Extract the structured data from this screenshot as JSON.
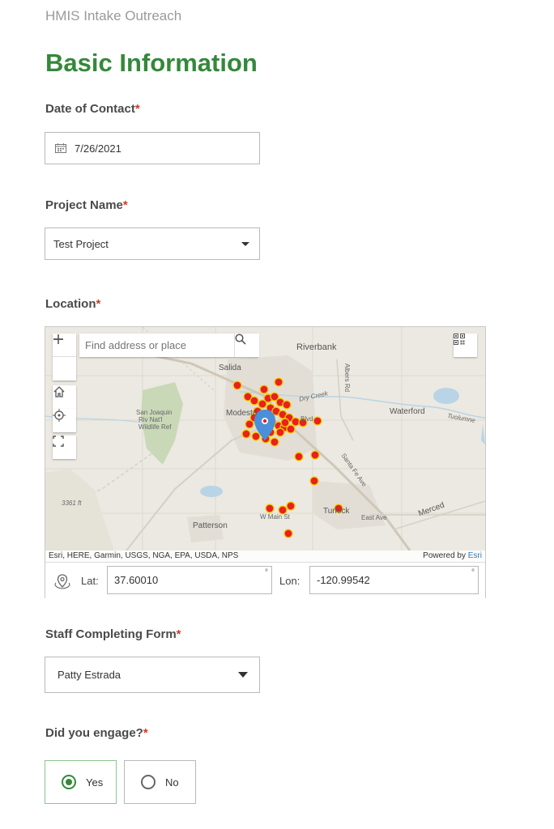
{
  "app": {
    "title": "HMIS Intake Outreach"
  },
  "section": {
    "title": "Basic Information"
  },
  "date_of_contact": {
    "label": "Date of Contact",
    "required_mark": "*",
    "value": "7/26/2021",
    "icon": "calendar-icon"
  },
  "project_name": {
    "label": "Project Name",
    "required_mark": "*",
    "value": "Test Project",
    "icon": "chevron-down-icon"
  },
  "location": {
    "label": "Location",
    "required_mark": "*",
    "map": {
      "search_placeholder": "Find address or place",
      "place_labels": {
        "riverbank": "Riverbank",
        "salida": "Salida",
        "modesto": "Modesto",
        "waterford": "Waterford",
        "san_joaquin": "San Joaquin",
        "riv_nat": "Riv Nat'l",
        "wildlife": "Wildlife Ref",
        "patterson": "Patterson",
        "turlock": "Turlock",
        "dry_creek": "Dry Creek",
        "albers": "Albers Rd",
        "santa_fe": "Santa Fe Ave",
        "merced": "Merced",
        "tuolumne": "Tuolumne",
        "east_ave": "East Ave",
        "w_main": "W Main St",
        "elev": "3361 ft",
        "blvd": "Blvd"
      },
      "attribution": "Esri, HERE, Garmin, USGS, NGA, EPA, USDA, NPS",
      "powered_by": "Powered by",
      "powered_brand": "Esri",
      "marker_color": "#e82020",
      "marker_outline": "#f5d000",
      "pin_color": "#4a90d9"
    },
    "lat_label": "Lat:",
    "lat_value": "37.60010",
    "lon_label": "Lon:",
    "lon_value": "-120.99542",
    "degree_symbol": "°"
  },
  "staff": {
    "label": "Staff Completing Form",
    "required_mark": "*",
    "value": "Patty Estrada"
  },
  "engage": {
    "label": "Did you engage?",
    "required_mark": "*",
    "options": [
      {
        "label": "Yes",
        "selected": true
      },
      {
        "label": "No",
        "selected": false
      }
    ],
    "accent": "#35883a"
  }
}
